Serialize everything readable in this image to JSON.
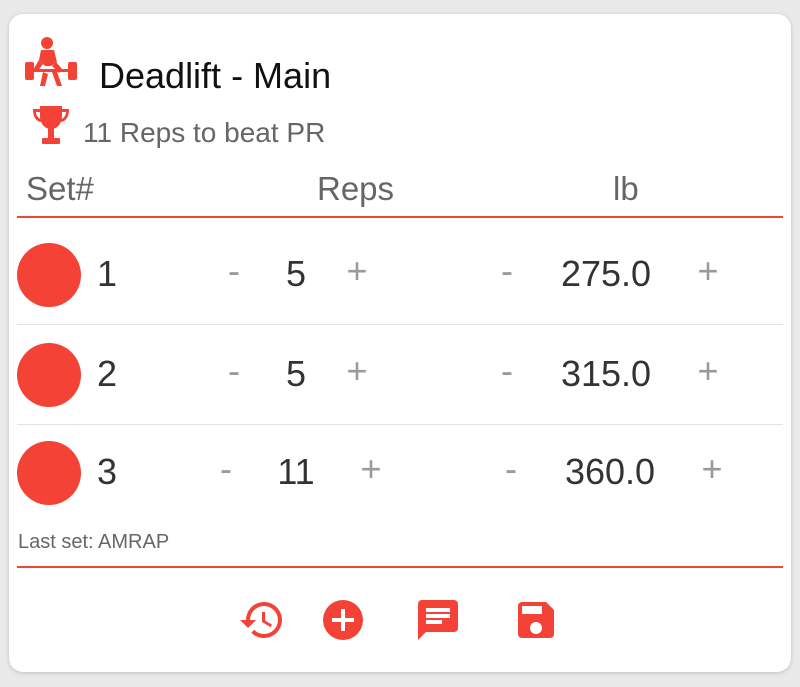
{
  "exercise": {
    "title": "Deadlift - Main",
    "pr_text": "11 Reps to beat PR",
    "icon": "deadlift-lifter-icon",
    "pr_icon": "trophy-icon"
  },
  "headers": {
    "set": "Set#",
    "reps": "Reps",
    "weight": "lb"
  },
  "controls": {
    "minus": "-",
    "plus": "+"
  },
  "sets": [
    {
      "number": "1",
      "reps": "5",
      "weight": "275.0"
    },
    {
      "number": "2",
      "reps": "5",
      "weight": "315.0"
    },
    {
      "number": "3",
      "reps": "11",
      "weight": "360.0"
    }
  ],
  "note": "Last set: AMRAP",
  "actions": [
    "history-icon",
    "add-circle-icon",
    "comment-icon",
    "save-icon"
  ],
  "colors": {
    "accent": "#f44336",
    "line": "#f04437",
    "muted": "#9a9a9a"
  }
}
